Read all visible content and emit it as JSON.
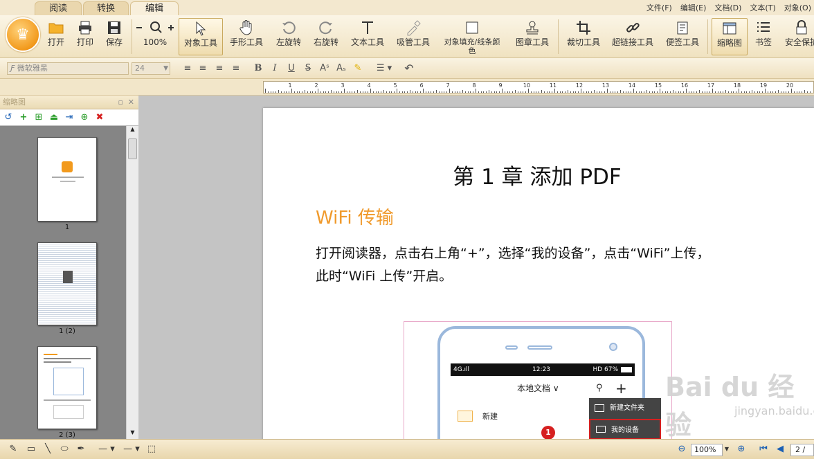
{
  "tabs": [
    "阅读",
    "转换",
    "编辑"
  ],
  "menus": [
    "文件(F)",
    "编辑(E)",
    "文档(D)",
    "文本(T)",
    "对象(O)"
  ],
  "ribbon": {
    "open": "打开",
    "print": "打印",
    "save": "保存",
    "zoom": "100%",
    "object_tool": "对象工具",
    "hand_tool": "手形工具",
    "rotate_left": "左旋转",
    "rotate_right": "右旋转",
    "text_tool": "文本工具",
    "picker_tool": "吸管工具",
    "fill_tool_1": "对象填充/线条颜",
    "fill_tool_2": "色",
    "stamp_tool": "图章工具",
    "crop_tool": "裁切工具",
    "link_tool": "超链接工具",
    "note_tool": "便签工具",
    "thumbnail": "缩略图",
    "bookmark": "书签",
    "security": "安全保护"
  },
  "format": {
    "font": "微软雅黑",
    "size": "24"
  },
  "ruler": {
    "labels": [
      "1",
      "2",
      "3",
      "4",
      "5",
      "6",
      "7",
      "8",
      "9",
      "10",
      "11",
      "12",
      "13",
      "14",
      "15",
      "16",
      "17",
      "18",
      "19",
      "20"
    ]
  },
  "thumbpanel": {
    "title": "缩略图",
    "labels": [
      "1",
      "1 (2)",
      "2 (3)"
    ]
  },
  "doc": {
    "chapter_title": "第 1 章 添加 PDF",
    "section_title": "WiFi 传输",
    "paragraph_1": "打开阅读器，点击右上角“+”，选择“我的设备”，点击“WiFi”上传，",
    "paragraph_2": "此时“WiFi 上传”开启。"
  },
  "phone": {
    "status_left": "4G.ıll",
    "status_time": "12:23",
    "status_right": "HD 67%",
    "header": "本地文档 ∨",
    "new_folder_row": "新建",
    "menu_new_folder": "新建文件夹",
    "menu_my_device": "我的设备",
    "badge": "1"
  },
  "watermark": {
    "main": "Bai du 经验",
    "sub": "jingyan.baidu.com"
  },
  "status": {
    "zoom": "100%",
    "page": "2 /"
  }
}
